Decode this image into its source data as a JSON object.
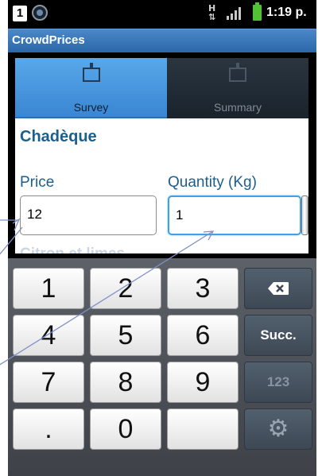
{
  "status_bar": {
    "sim_slot": "1",
    "data_indicator": "H",
    "time": "1:19 p."
  },
  "app": {
    "title": "CrowdPrices"
  },
  "tabs": [
    {
      "label": "Survey",
      "icon": "tv-icon",
      "active": true
    },
    {
      "label": "Summary",
      "icon": "tv-icon",
      "active": false
    }
  ],
  "survey": {
    "product_name": "Chadèque",
    "price_label": "Price",
    "price_value": "12",
    "quantity_label": "Quantity (Kg)",
    "quantity_value": "1",
    "next_item_partial": "Citron et limes"
  },
  "keyboard": {
    "keys": [
      "1",
      "2",
      "3",
      "4",
      "5",
      "6",
      "7",
      "8",
      "9",
      ".",
      "0"
    ],
    "next_label": "Succ.",
    "mode_label": "123",
    "backspace_icon": "backspace-icon",
    "settings_icon": "gear-icon"
  },
  "colors": {
    "title_bar": "#3a78bc",
    "active_tab": "#4a98e0",
    "label_text": "#1c5f8e",
    "focus_border": "#3ea0e8"
  }
}
